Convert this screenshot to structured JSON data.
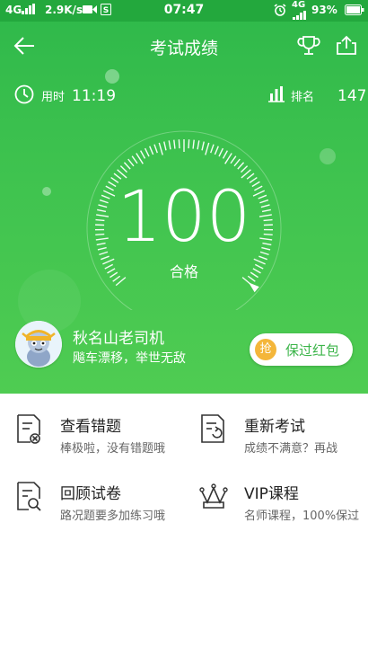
{
  "status_bar": {
    "network": "4G",
    "speed": "2.9K/s",
    "time": "07:47",
    "network2": "4G",
    "battery": "93%"
  },
  "header": {
    "title": "考试成绩",
    "icons": [
      "back-arrow-icon",
      "trophy-icon",
      "share-icon"
    ]
  },
  "stats": {
    "time_label": "用时",
    "time_value": "11:19",
    "rank_label": "排名",
    "rank_value": "147"
  },
  "result": {
    "score": "100",
    "status": "合格",
    "progress_fraction": 1.0
  },
  "user": {
    "name": "秋名山老司机",
    "motto": "飚车漂移，举世无敌"
  },
  "red_packet": {
    "badge": "抢",
    "label": "保过红包"
  },
  "menu": [
    {
      "title": "查看错题",
      "subtitle": "棒极啦，没有错题哦",
      "icon": "wrong-questions-icon"
    },
    {
      "title": "重新考试",
      "subtitle": "成绩不满意？再战",
      "icon": "retake-exam-icon"
    },
    {
      "title": "回顾试卷",
      "subtitle": "路况题要多加练习哦",
      "icon": "review-paper-icon"
    },
    {
      "title": "VIP课程",
      "subtitle": "名师课程，100%保过",
      "icon": "crown-icon"
    }
  ],
  "colors": {
    "primary_green": "#3fc34f",
    "status_bar_green": "#23a83d",
    "coin_orange": "#f4b63a"
  }
}
